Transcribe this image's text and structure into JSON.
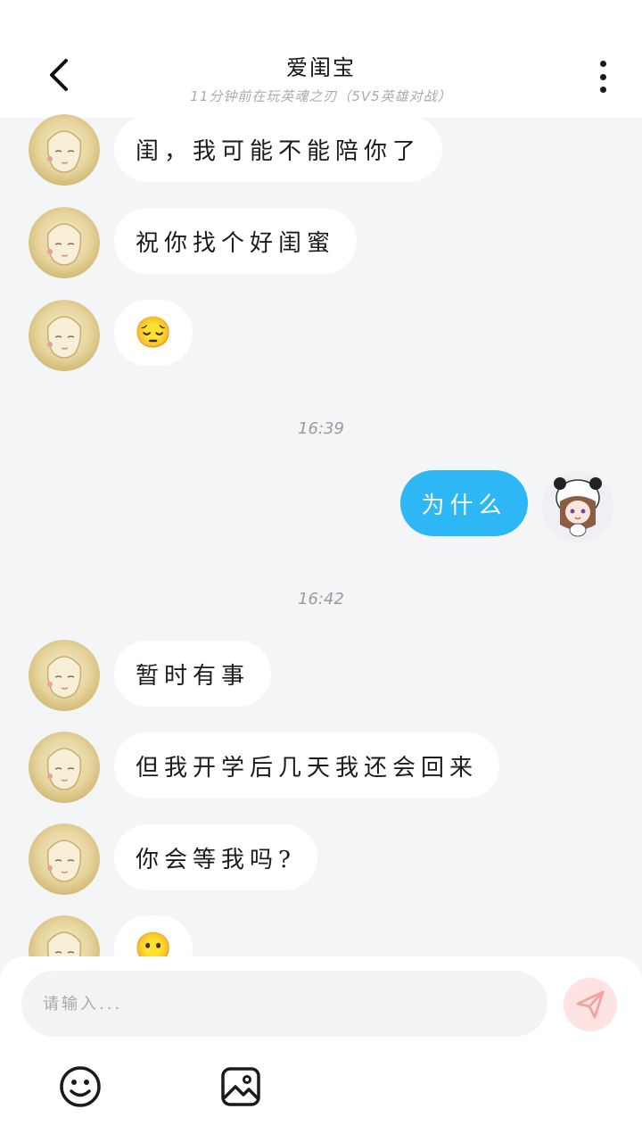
{
  "header": {
    "title": "爱闺宝",
    "subtitle": "11分钟前在玩英魂之刃（5V5英雄对战）",
    "back_icon": "chevron-left-icon",
    "more_icon": "more-vertical-icon"
  },
  "messages": [
    {
      "sender": "friend",
      "text": "闺，我可能不能陪你了"
    },
    {
      "sender": "friend",
      "text": "祝你找个好闺蜜"
    },
    {
      "sender": "friend",
      "text": "😔"
    },
    {
      "timestamp": "16:39"
    },
    {
      "sender": "me",
      "text": "为什么"
    },
    {
      "timestamp": "16:42"
    },
    {
      "sender": "friend",
      "text": "暂时有事"
    },
    {
      "sender": "friend",
      "text": "但我开学后几天我还会回来"
    },
    {
      "sender": "friend",
      "text": "你会等我吗?"
    },
    {
      "sender": "friend",
      "text": "😶"
    }
  ],
  "input": {
    "placeholder": "请输入...",
    "value": "",
    "send_icon": "paper-plane-icon"
  },
  "toolbar": {
    "emoji_icon": "smiley-icon",
    "image_icon": "image-icon"
  },
  "colors": {
    "background": "#f4f5f7",
    "my_bubble": "#2db7f5",
    "friend_bubble": "#ffffff",
    "send_button": "#fde3e1",
    "send_icon": "#f3a39e"
  }
}
